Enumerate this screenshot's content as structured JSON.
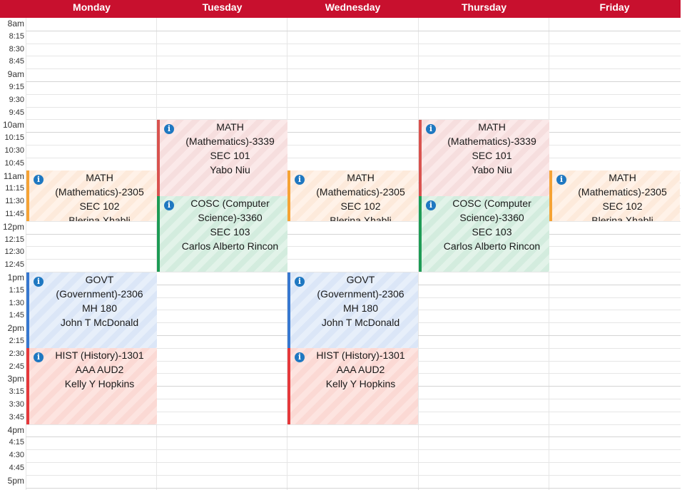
{
  "days": [
    "Monday",
    "Tuesday",
    "Wednesday",
    "Thursday",
    "Friday"
  ],
  "times": [
    "8am",
    "8:15",
    "8:30",
    "8:45",
    "9am",
    "9:15",
    "9:30",
    "9:45",
    "10am",
    "10:15",
    "10:30",
    "10:45",
    "11am",
    "11:15",
    "11:30",
    "11:45",
    "12pm",
    "12:15",
    "12:30",
    "12:45",
    "1pm",
    "1:15",
    "1:30",
    "1:45",
    "2pm",
    "2:15",
    "2:30",
    "2:45",
    "3pm",
    "3:15",
    "3:30",
    "3:45",
    "4pm",
    "4:15",
    "4:30",
    "4:45",
    "5pm"
  ],
  "info_icon": "info-icon",
  "colors": {
    "header": "#c8102e",
    "math_mwf_accent": "#f5a335",
    "math_tr_accent": "#d9534f",
    "cosc_accent": "#1e9b55",
    "govt_accent": "#3778d0",
    "hist_accent": "#e5383b",
    "info_icon": "#1f78c1"
  },
  "events": [
    {
      "day": 0,
      "start": "11am",
      "end": "12pm",
      "color": "orange",
      "lines": [
        "MATH (Mathematics)-2305",
        "SEC 102",
        "Blerina Xhabli"
      ]
    },
    {
      "day": 2,
      "start": "11am",
      "end": "12pm",
      "color": "orange",
      "lines": [
        "MATH (Mathematics)-2305",
        "SEC 102",
        "Blerina Xhabli"
      ]
    },
    {
      "day": 4,
      "start": "11am",
      "end": "12pm",
      "color": "orange",
      "lines": [
        "MATH (Mathematics)-2305",
        "SEC 102",
        "Blerina Xhabli"
      ]
    },
    {
      "day": 1,
      "start": "10am",
      "end": "11:30",
      "color": "pink",
      "lines": [
        "MATH (Mathematics)-3339",
        "SEC 101",
        "Yabo Niu"
      ]
    },
    {
      "day": 3,
      "start": "10am",
      "end": "11:30",
      "color": "pink",
      "lines": [
        "MATH (Mathematics)-3339",
        "SEC 101",
        "Yabo Niu"
      ]
    },
    {
      "day": 1,
      "start": "11:30",
      "end": "1pm",
      "color": "green",
      "lines": [
        "COSC (Computer Science)-3360",
        "SEC 103",
        "Carlos Alberto Rincon"
      ]
    },
    {
      "day": 3,
      "start": "11:30",
      "end": "1pm",
      "color": "green",
      "lines": [
        "COSC (Computer Science)-3360",
        "SEC 103",
        "Carlos Alberto Rincon"
      ]
    },
    {
      "day": 0,
      "start": "1pm",
      "end": "2:30",
      "color": "blue",
      "lines": [
        "GOVT (Government)-2306",
        "MH 180",
        "John T McDonald"
      ]
    },
    {
      "day": 2,
      "start": "1pm",
      "end": "2:30",
      "color": "blue",
      "lines": [
        "GOVT (Government)-2306",
        "MH 180",
        "John T McDonald"
      ]
    },
    {
      "day": 0,
      "start": "2:30",
      "end": "4pm",
      "color": "red",
      "lines": [
        "HIST (History)-1301",
        "AAA AUD2",
        "Kelly Y Hopkins"
      ]
    },
    {
      "day": 2,
      "start": "2:30",
      "end": "4pm",
      "color": "red",
      "lines": [
        "HIST (History)-1301",
        "AAA AUD2",
        "Kelly Y Hopkins"
      ]
    }
  ]
}
